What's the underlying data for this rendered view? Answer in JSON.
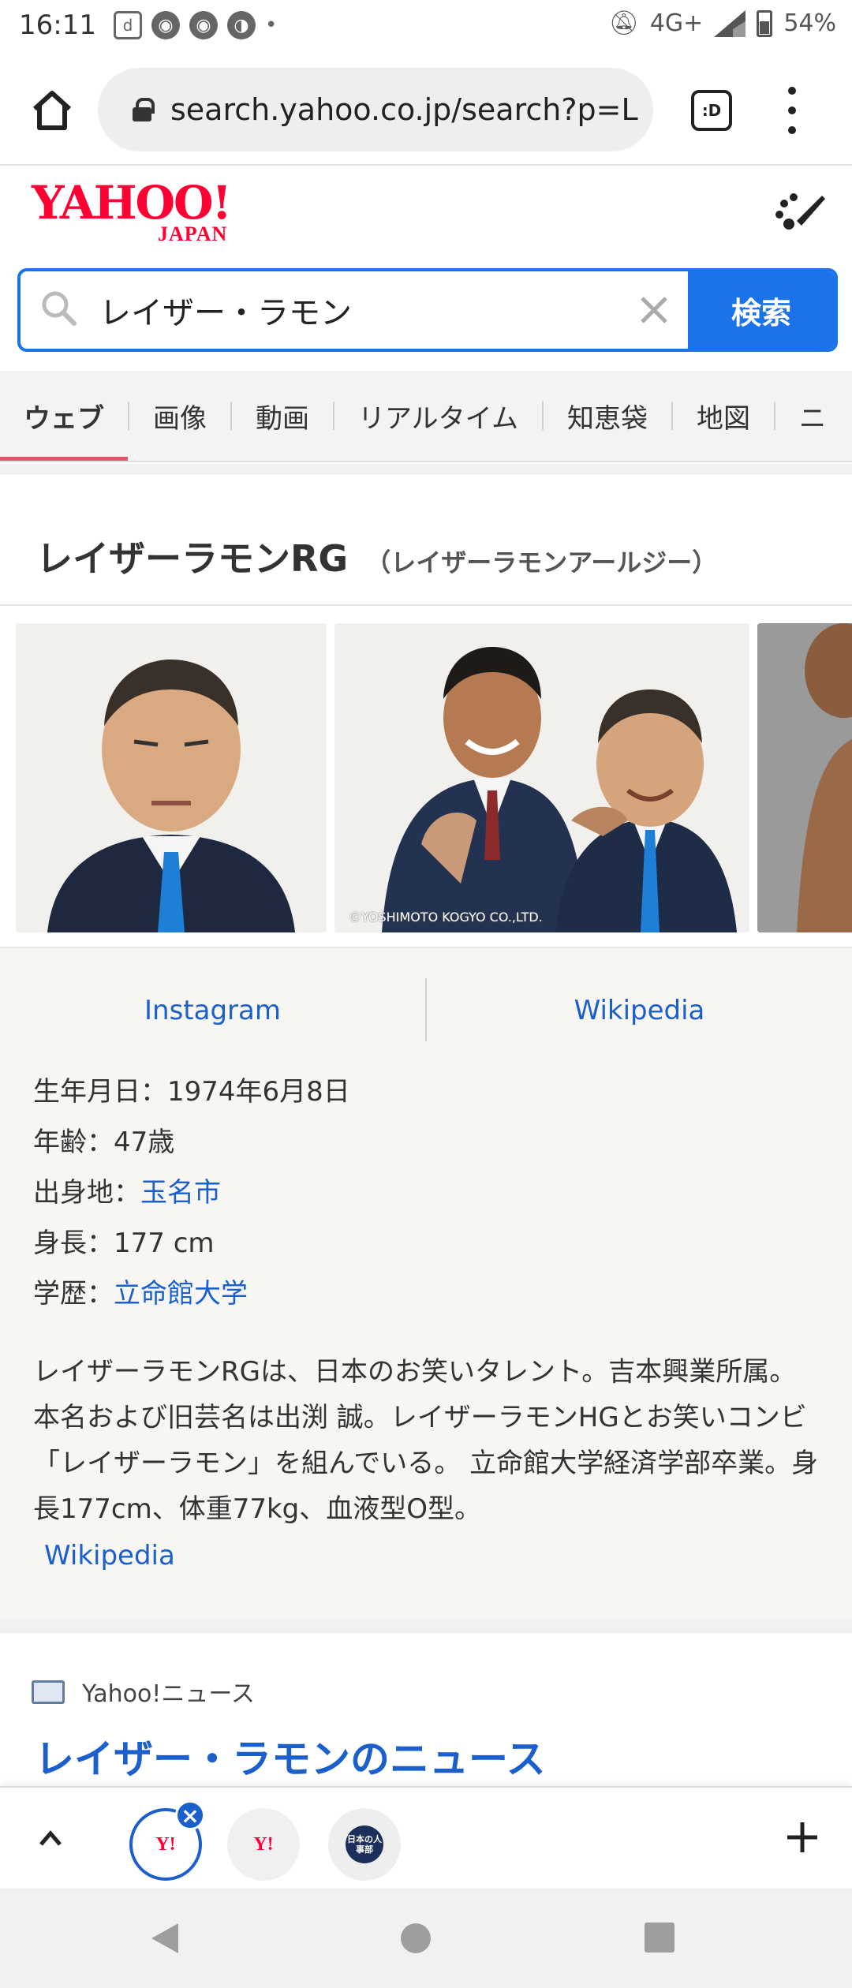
{
  "status_bar": {
    "time": "16:11",
    "network": "4G+",
    "battery": "54%"
  },
  "browser": {
    "url": "search.yahoo.co.jp/search?p=L",
    "tabs_label": ":D"
  },
  "logo": {
    "main": "YAHOO!",
    "sub": "JAPAN"
  },
  "search": {
    "query": "レイザー・ラモン",
    "button": "検索"
  },
  "nav_tabs": [
    {
      "label": "ウェブ"
    },
    {
      "label": "画像"
    },
    {
      "label": "動画"
    },
    {
      "label": "リアルタイム"
    },
    {
      "label": "知恵袋"
    },
    {
      "label": "地図"
    },
    {
      "label": "ニ"
    }
  ],
  "knowledge_panel": {
    "title": "レイザーラモンRG",
    "reading": "（レイザーラモンアールジー）",
    "image_copyright": "©YOSHIMOTO KOGYO CO.,LTD.",
    "links": {
      "instagram": "Instagram",
      "wikipedia": "Wikipedia"
    },
    "facts": {
      "birth_label": "生年月日：",
      "birth_value": "1974年6月8日",
      "age_label": "年齢：",
      "age_value": "47歳",
      "hometown_label": "出身地：",
      "hometown_value": "玉名市",
      "height_label": "身長：",
      "height_value": "177 cm",
      "education_label": "学歴：",
      "education_value": "立命館大学"
    },
    "description": "レイザーラモンRGは、日本のお笑いタレント。吉本興業所属。本名および旧芸名は出渕 誠。レイザーラモンHGとお笑いコンビ「レイザーラモン」を組んでいる。 立命館大学経済学部卒業。身長177cm、体重77kg、血液型O型。",
    "description_source": "Wikipedia"
  },
  "news": {
    "source": "Yahoo!ニュース",
    "title": "レイザー・ラモンのニュース"
  },
  "tabstrip": {
    "tab_icon_label": "Y!",
    "third_tab_label": "日本の人事部"
  },
  "colors": {
    "accent_blue": "#1a73e8",
    "link_blue": "#1a5fcc",
    "yahoo_red": "#ff0033",
    "active_tab_underline": "#e5546c"
  }
}
